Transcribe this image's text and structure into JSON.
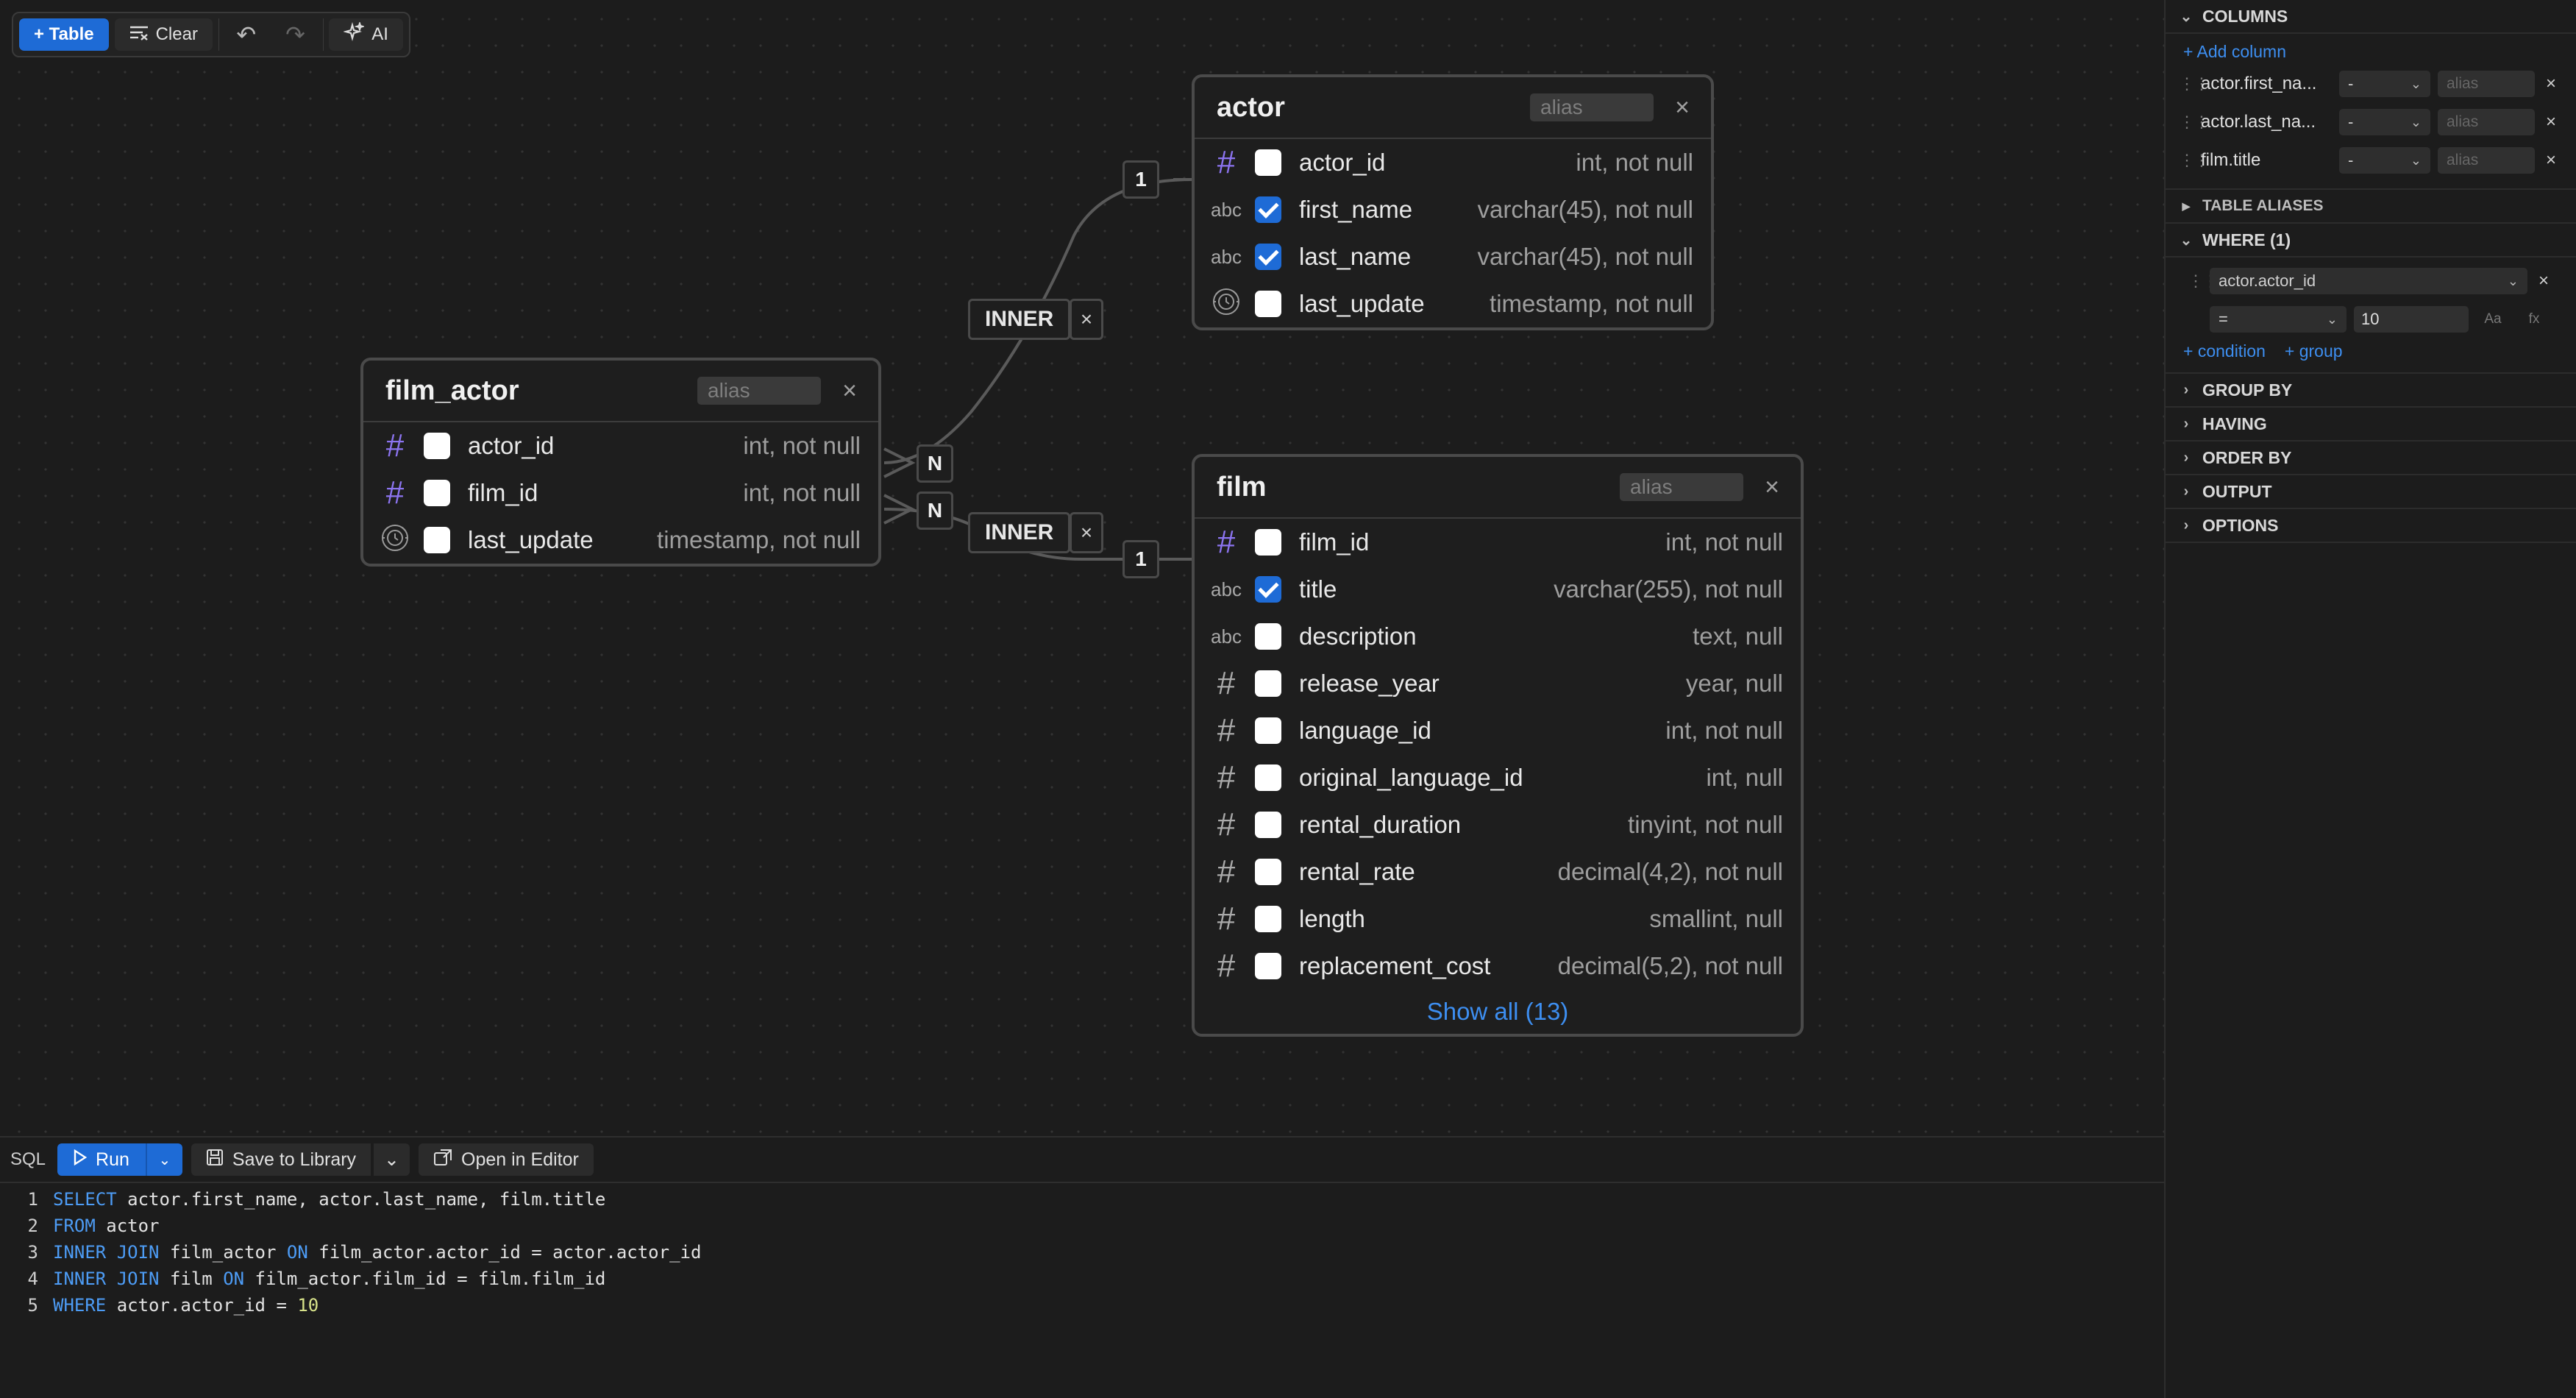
{
  "toolbar": {
    "table_label": "+ Table",
    "clear_label": "Clear",
    "undo_glyph": "↶",
    "redo_glyph": "↷",
    "ai_label": "AI"
  },
  "tables": {
    "actor": {
      "name": "actor",
      "alias_placeholder": "alias",
      "close": "×",
      "fields": [
        {
          "icon": "hash",
          "name": "actor_id",
          "type": "int, not null",
          "checked": false
        },
        {
          "icon": "abc",
          "name": "first_name",
          "type": "varchar(45), not null",
          "checked": true
        },
        {
          "icon": "abc",
          "name": "last_name",
          "type": "varchar(45), not null",
          "checked": true
        },
        {
          "icon": "clock",
          "name": "last_update",
          "type": "timestamp, not null",
          "checked": false
        }
      ]
    },
    "film_actor": {
      "name": "film_actor",
      "alias_placeholder": "alias",
      "close": "×",
      "fields": [
        {
          "icon": "hash",
          "name": "actor_id",
          "type": "int, not null",
          "checked": false
        },
        {
          "icon": "hash",
          "name": "film_id",
          "type": "int, not null",
          "checked": false
        },
        {
          "icon": "clock",
          "name": "last_update",
          "type": "timestamp, not null",
          "checked": false
        }
      ]
    },
    "film": {
      "name": "film",
      "alias_placeholder": "alias",
      "close": "×",
      "fields": [
        {
          "icon": "hash",
          "name": "film_id",
          "type": "int, not null",
          "checked": false
        },
        {
          "icon": "abc",
          "name": "title",
          "type": "varchar(255), not null",
          "checked": true
        },
        {
          "icon": "abc",
          "name": "description",
          "type": "text, null",
          "checked": false
        },
        {
          "icon": "hash-grey",
          "name": "release_year",
          "type": "year, null",
          "checked": false
        },
        {
          "icon": "hash-grey",
          "name": "language_id",
          "type": "int, not null",
          "checked": false
        },
        {
          "icon": "hash-grey",
          "name": "original_language_id",
          "type": "int, null",
          "checked": false
        },
        {
          "icon": "hash-grey",
          "name": "rental_duration",
          "type": "tinyint, not null",
          "checked": false
        },
        {
          "icon": "hash-grey",
          "name": "rental_rate",
          "type": "decimal(4,2), not null",
          "checked": false
        },
        {
          "icon": "hash-grey",
          "name": "length",
          "type": "smallint, null",
          "checked": false
        },
        {
          "icon": "hash-grey",
          "name": "replacement_cost",
          "type": "decimal(5,2), not null",
          "checked": false
        }
      ],
      "show_all": "Show all (13)"
    }
  },
  "joins": {
    "j1": {
      "type": "INNER",
      "close": "×",
      "left_card": "N",
      "right_card": "1"
    },
    "j2": {
      "type": "INNER",
      "close": "×",
      "left_card": "N",
      "right_card": "1"
    }
  },
  "sql": {
    "label": "SQL",
    "run_label": "Run",
    "save_label": "Save to Library",
    "open_label": "Open in Editor",
    "lines": [
      {
        "n": "1",
        "parts": [
          {
            "t": "kw",
            "v": "SELECT"
          },
          {
            "t": "tx",
            "v": " actor.first_name, actor.last_name, film.title"
          }
        ]
      },
      {
        "n": "2",
        "parts": [
          {
            "t": "kw",
            "v": "FROM"
          },
          {
            "t": "tx",
            "v": " actor"
          }
        ]
      },
      {
        "n": "3",
        "parts": [
          {
            "t": "kw",
            "v": "INNER JOIN"
          },
          {
            "t": "tx",
            "v": " film_actor "
          },
          {
            "t": "kw",
            "v": "ON"
          },
          {
            "t": "tx",
            "v": " film_actor.actor_id = actor.actor_id"
          }
        ]
      },
      {
        "n": "4",
        "parts": [
          {
            "t": "kw",
            "v": "INNER JOIN"
          },
          {
            "t": "tx",
            "v": " film "
          },
          {
            "t": "kw",
            "v": "ON"
          },
          {
            "t": "tx",
            "v": " film_actor.film_id = film.film_id"
          }
        ]
      },
      {
        "n": "5",
        "parts": [
          {
            "t": "kw",
            "v": "WHERE"
          },
          {
            "t": "tx",
            "v": " actor.actor_id = "
          },
          {
            "t": "num",
            "v": "10"
          }
        ]
      }
    ]
  },
  "panel": {
    "columns": {
      "title": "COLUMNS",
      "add_label": "+ Add column",
      "items": [
        {
          "name": "actor.first_na...",
          "agg": "-",
          "alias_placeholder": "alias"
        },
        {
          "name": "actor.last_na...",
          "agg": "-",
          "alias_placeholder": "alias"
        },
        {
          "name": "film.title",
          "agg": "-",
          "alias_placeholder": "alias"
        }
      ]
    },
    "table_aliases": {
      "title": "TABLE ALIASES"
    },
    "where": {
      "title": "WHERE (1)",
      "field": "actor.actor_id",
      "operator": "=",
      "value": "10",
      "case_btn": "Aa",
      "fx_btn": "fx",
      "add_condition": "+ condition",
      "add_group": "+ group"
    },
    "sections": [
      "GROUP BY",
      "HAVING",
      "ORDER BY",
      "OUTPUT",
      "OPTIONS"
    ]
  }
}
